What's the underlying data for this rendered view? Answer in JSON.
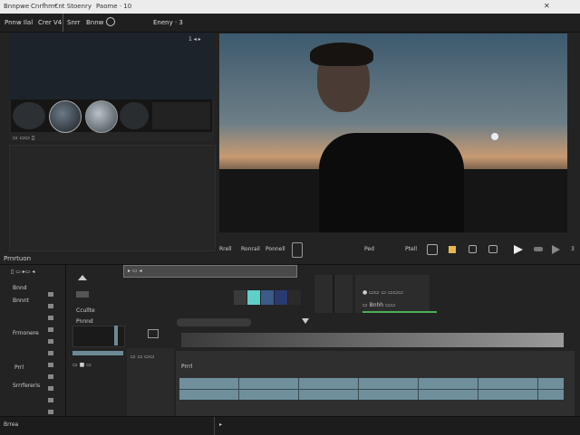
{
  "window": {
    "title_left": "Bnnpwe",
    "title_mid": "Cnrfhm€nt Stoenry",
    "title_right": "Paome  · 10"
  },
  "menu": {
    "items": [
      "Pnnw Ilal",
      "Crer V4",
      "Snrr",
      "Bnnw"
    ],
    "center_label": "Eneny · 3"
  },
  "source_panel": {
    "corner_label": "1 ◂ ▸",
    "footer_label": "▭ ▭▭  ▯"
  },
  "viewer": {
    "controls": [
      "Rrell",
      "Ronrail",
      "Ponnell"
    ],
    "right_label": "Ped",
    "timecode_label": "Ptell",
    "page_num": "3"
  },
  "section": {
    "title": "Prnrtuon"
  },
  "inspector": {
    "items": [
      "Bnnd",
      "Bnnnt",
      "Frrnonere",
      "Prrl",
      "Srrrfereris"
    ]
  },
  "effects": {
    "label1": "Ccullte",
    "label2": "Pnnnd",
    "chip": "▭ ■ ▭"
  },
  "timeline": {
    "header_label": "▸ ▭ ◂",
    "sub_label": "▭ ▭ ▭▭",
    "clip_label": "● ▭▭ ▭ ▭▭▭",
    "right_label": "▭ Bnhh ▭▭",
    "track_label": "Prrrl"
  },
  "status": {
    "left": "Brrea",
    "right": "▸"
  },
  "swatch_colors": [
    "#3a3a3a",
    "#5ed0c8",
    "#3c5a8a",
    "#2a3a70",
    "#2a2a2a"
  ]
}
